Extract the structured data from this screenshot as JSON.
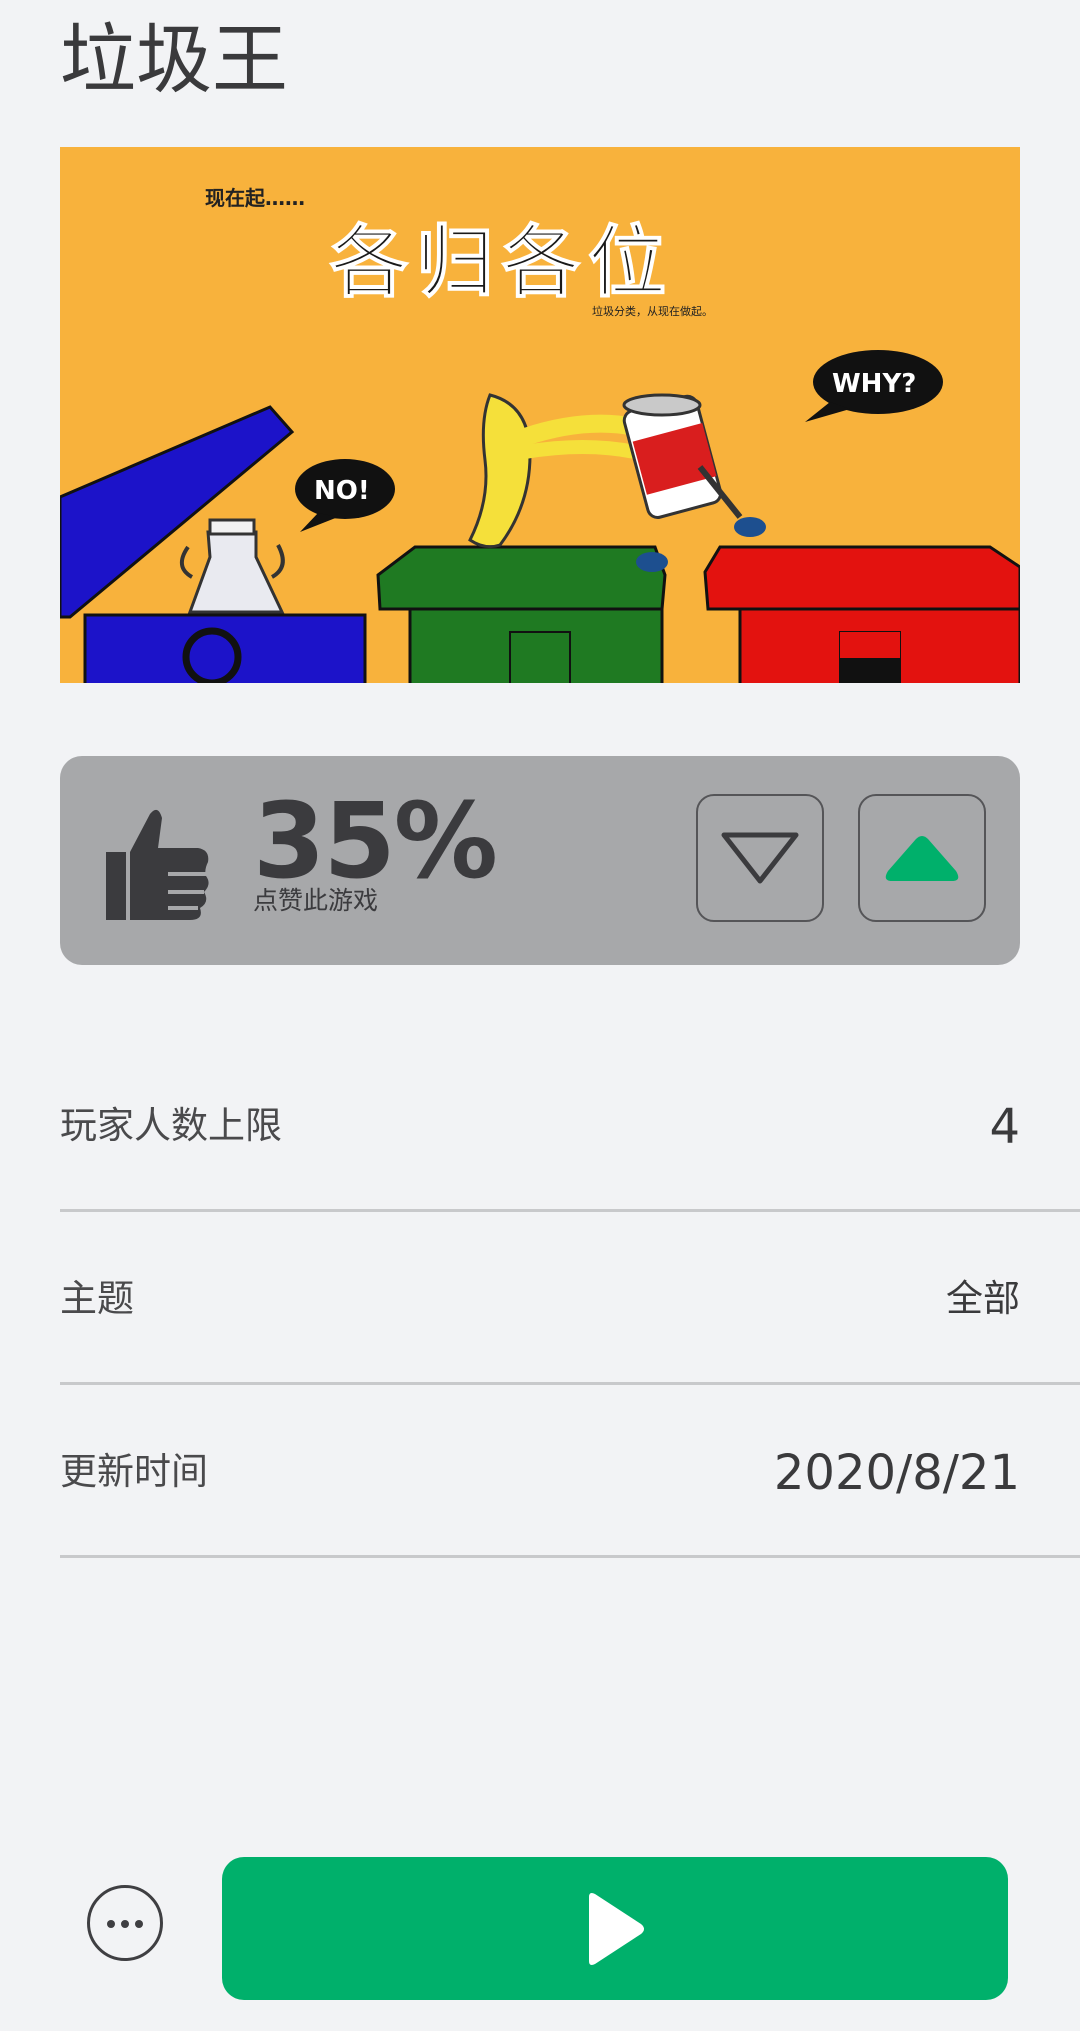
{
  "game": {
    "title": "垃圾王"
  },
  "banner": {
    "kicker": "现在起……",
    "headline": "各归各位",
    "sub": "垃圾分类，从现在做起。",
    "bubble_no": "NO!",
    "bubble_why": "WHY?",
    "bin_colors": [
      "#1c13c9",
      "#1f7a22",
      "#e3120f"
    ],
    "background": "#f8b23c"
  },
  "rating": {
    "percent": "35%",
    "value": 0.35,
    "label": "点赞此游戏",
    "up_color": "#00b06b"
  },
  "info": [
    {
      "label": "玩家人数上限",
      "value": "4"
    },
    {
      "label": "主题",
      "value": "全部"
    },
    {
      "label": "更新时间",
      "value": "2020/8/21"
    }
  ],
  "actions": {
    "more_icon": "more-icon",
    "play_icon": "play-icon",
    "play_color": "#00b06b"
  }
}
